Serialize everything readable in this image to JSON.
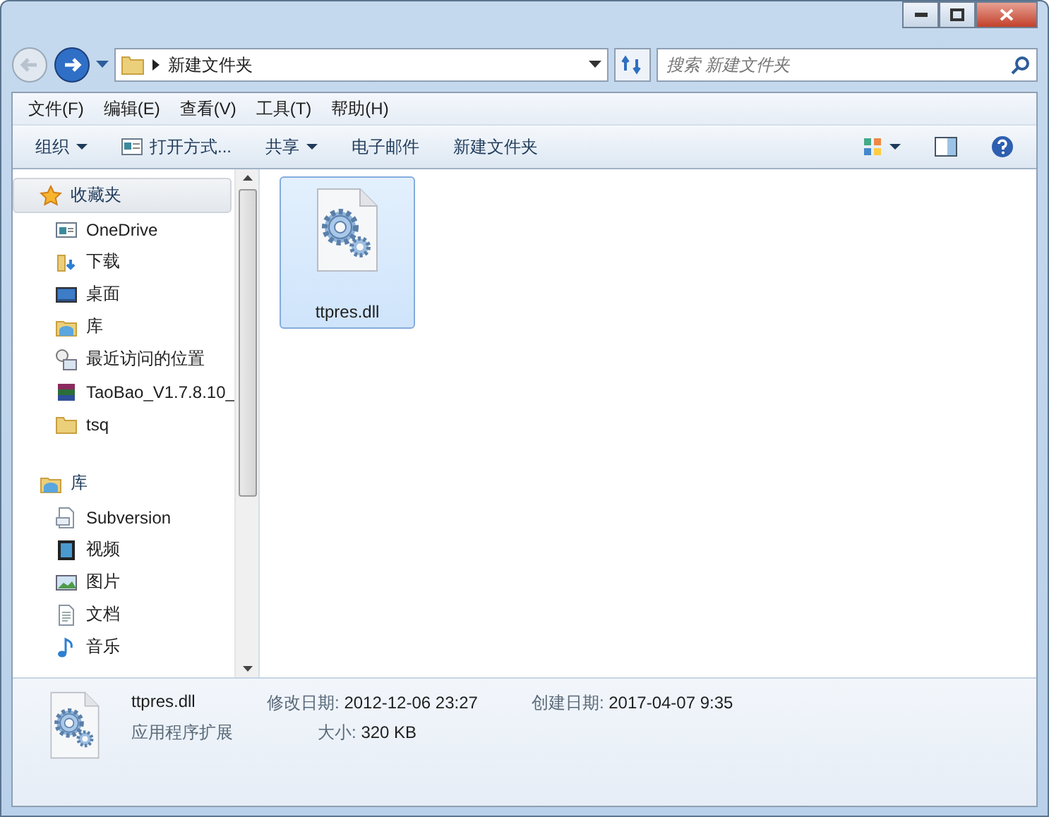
{
  "address": {
    "path": "新建文件夹"
  },
  "search": {
    "placeholder": "搜索 新建文件夹"
  },
  "menu": [
    "文件(F)",
    "编辑(E)",
    "查看(V)",
    "工具(T)",
    "帮助(H)"
  ],
  "toolbar": [
    {
      "label": "组织",
      "kind": "menu"
    },
    {
      "label": "打开方式...",
      "kind": "app"
    },
    {
      "label": "共享",
      "kind": "menu"
    },
    {
      "label": "电子邮件",
      "kind": "command"
    },
    {
      "label": "新建文件夹",
      "kind": "command"
    }
  ],
  "sidebar": [
    {
      "label": "收藏夹",
      "kind": "star",
      "selected": true,
      "children": [
        {
          "label": "OneDrive",
          "kind": "onedrive"
        },
        {
          "label": "下载",
          "kind": "download"
        },
        {
          "label": "桌面",
          "kind": "desktop"
        },
        {
          "label": "库",
          "kind": "library"
        },
        {
          "label": "最近访问的位置",
          "kind": "recent"
        },
        {
          "label": "TaoBao_V1.7.8.10_",
          "kind": "archive"
        },
        {
          "label": "tsq",
          "kind": "folder"
        }
      ]
    },
    {
      "label": "库",
      "kind": "library",
      "selected": false,
      "children": [
        {
          "label": "Subversion",
          "kind": "subversion"
        },
        {
          "label": "视频",
          "kind": "video"
        },
        {
          "label": "图片",
          "kind": "picture"
        },
        {
          "label": "文档",
          "kind": "document"
        },
        {
          "label": "音乐",
          "kind": "music"
        }
      ]
    }
  ],
  "files": [
    {
      "name": "ttpres.dll",
      "selected": true
    }
  ],
  "details": {
    "name": "ttpres.dll",
    "type": "应用程序扩展",
    "modified_label": "修改日期:",
    "modified": "2012-12-06 23:27",
    "size_label": "大小:",
    "size": "320 KB",
    "created_label": "创建日期:",
    "created": "2017-04-07 9:35"
  }
}
